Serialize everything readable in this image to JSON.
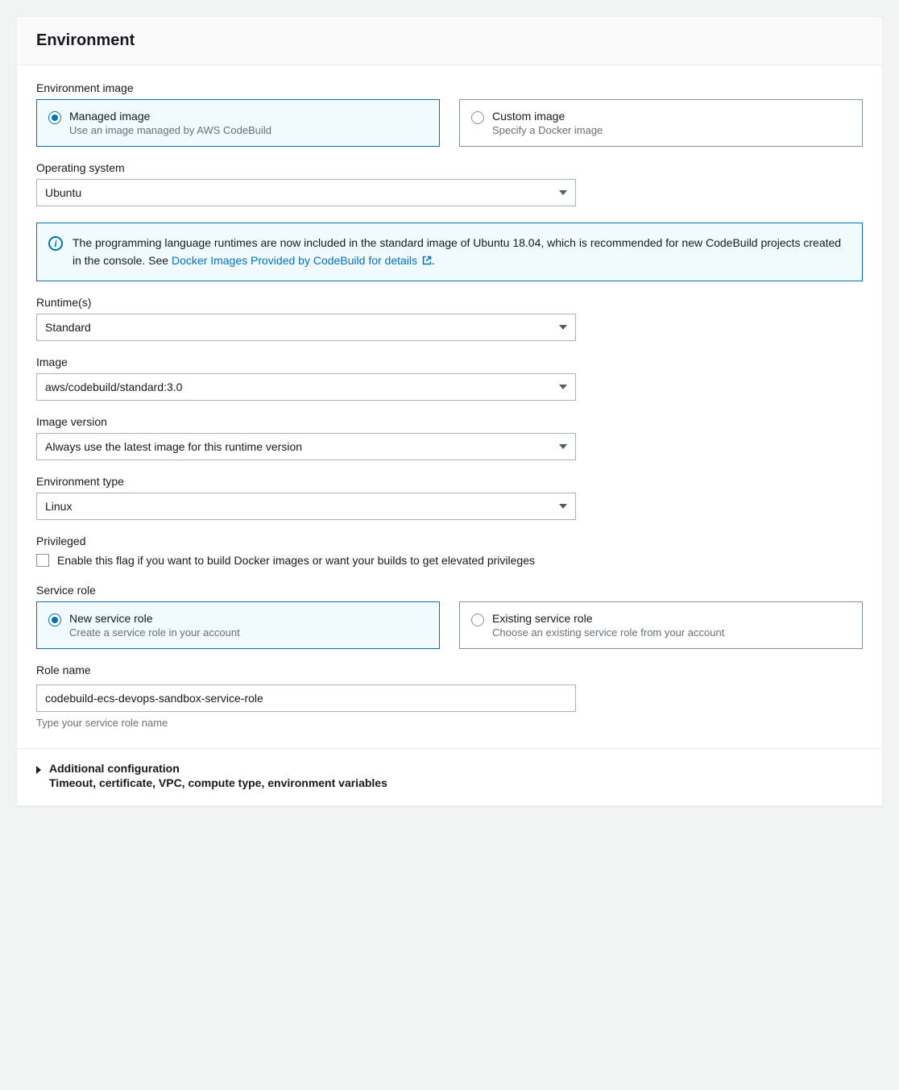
{
  "header": {
    "title": "Environment"
  },
  "env_image": {
    "label": "Environment image",
    "managed": {
      "title": "Managed image",
      "desc": "Use an image managed by AWS CodeBuild"
    },
    "custom": {
      "title": "Custom image",
      "desc": "Specify a Docker image"
    }
  },
  "os": {
    "label": "Operating system",
    "value": "Ubuntu"
  },
  "info_box": {
    "text_before_link": "The programming language runtimes are now included in the standard image of Ubuntu 18.04, which is recommended for new CodeBuild projects created in the console. See ",
    "link_text": "Docker Images Provided by CodeBuild for details",
    "text_after_link": "."
  },
  "runtime": {
    "label": "Runtime(s)",
    "value": "Standard"
  },
  "image": {
    "label": "Image",
    "value": "aws/codebuild/standard:3.0"
  },
  "image_version": {
    "label": "Image version",
    "value": "Always use the latest image for this runtime version"
  },
  "env_type": {
    "label": "Environment type",
    "value": "Linux"
  },
  "privileged": {
    "label": "Privileged",
    "checkbox_label": "Enable this flag if you want to build Docker images or want your builds to get elevated privileges"
  },
  "service_role": {
    "label": "Service role",
    "new": {
      "title": "New service role",
      "desc": "Create a service role in your account"
    },
    "existing": {
      "title": "Existing service role",
      "desc": "Choose an existing service role from your account"
    }
  },
  "role_name": {
    "label": "Role name",
    "value": "codebuild-ecs-devops-sandbox-service-role",
    "helper": "Type your service role name"
  },
  "additional": {
    "title": "Additional configuration",
    "desc": "Timeout, certificate, VPC, compute type, environment variables"
  }
}
